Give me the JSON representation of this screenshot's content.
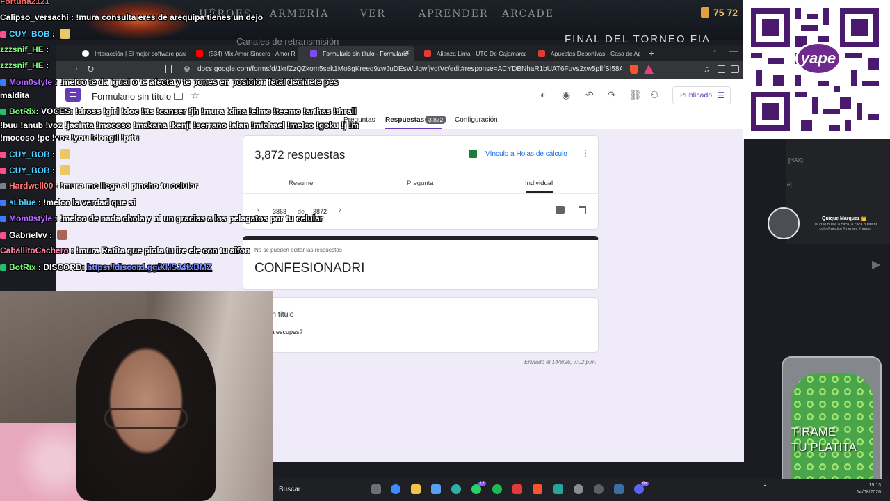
{
  "game": {
    "nav": [
      "HÉROES",
      "ARMERÍA",
      "VER",
      "APRENDER",
      "ARCADE"
    ],
    "gold": "75 72",
    "tournament": "FINAL DEL TORNEO FIA",
    "streams_label": "Canales de retransmisión"
  },
  "browser": {
    "tabs": [
      {
        "label": "Interacción | El mejor software para p",
        "active": false
      },
      {
        "label": "(534) Mix Amor Sincero - Amor R",
        "active": false
      },
      {
        "label": "Formulario sin título - Formulario",
        "active": true
      },
      {
        "label": "Alianza Lima - UTC De Cajamarca Fút",
        "active": false
      },
      {
        "label": "Apuestas Deportivas - Casa de Apue",
        "active": false
      }
    ],
    "new_tab": "+",
    "url": "docs.google.com/forms/d/1krfZzQZkom5sek1Mo8gKreeq9zwJuDEsWUgwfjyqtVc/edit#response=ACYDBNhaR1bUAT6Fuvs2xw5pflfSI58AfA3HBQ..."
  },
  "forms": {
    "title": "Formulario sin título",
    "publish_label": "Publicado",
    "tabs": {
      "questions": "Preguntas",
      "responses": "Respuestas",
      "settings": "Configuración"
    },
    "response_badge": "3,872",
    "summary": {
      "count_text": "3,872 respuestas",
      "sheets_link": "Vínculo a Hojas de cálculo",
      "subtabs": {
        "summary": "Resumen",
        "question": "Pregunta",
        "individual": "Individual"
      },
      "current": "3863",
      "of": "de",
      "total": "3872"
    },
    "response": {
      "no_edit": "No se pueden editar las respuestas",
      "title": "CONFESIONADRI",
      "question": "nta sin título",
      "answer": "jas o la escupes?",
      "sent": "Enviado el 14/8/26, 7:02 p.m."
    }
  },
  "chat": [
    {
      "user": "Fortuna2121",
      "color": "#ff6a6a",
      "text": ""
    },
    {
      "user": "Calipso_versachi",
      "color": "#ffffff",
      "text": "!mura consulta eres de arequipa tienes un dejo"
    },
    {
      "user": "CUY_BOB",
      "color": "#4fd1ff",
      "text": ""
    },
    {
      "user": "zzzsnif_HE",
      "color": "#7dff7d",
      "text": ""
    },
    {
      "user": "zzzsnif_HE",
      "color": "#7dff7d",
      "text": ""
    },
    {
      "user": "Mom0style",
      "color": "#b36bff",
      "text": "!melco te da igual o te afecta y te pones en posicion fetal decidete pes"
    },
    {
      "user": "",
      "color": "#ffffff",
      "text": "maldita"
    },
    {
      "user": "BotRix",
      "color": "#7dff7d",
      "text": "VOCES: !dross !girl !doc !tts !canser !jh !mura !dina !elmo !teemo !arthas !thrall"
    },
    {
      "user": "",
      "color": "#ffffff",
      "text": "!buu !anub !voz !jacinta !mocoso !makana !kenji !serrano !alan !michael !melco !goku !j !m"
    },
    {
      "user": "",
      "color": "#ffffff",
      "text": "!mocoso !pe !voz !you !dongil !pitu"
    },
    {
      "user": "CUY_BOB",
      "color": "#4fd1ff",
      "text": ""
    },
    {
      "user": "CUY_BOB",
      "color": "#4fd1ff",
      "text": ""
    },
    {
      "user": "Hardwell00",
      "color": "#ff7b7b",
      "text": "!mura me llega al pincho tu celular"
    },
    {
      "user": "sLblue",
      "color": "#4fd1ff",
      "text": "!melco la verdad que si"
    },
    {
      "user": "Mom0style",
      "color": "#b36bff",
      "text": "!melco de nada chola y ni un gracias a los pelagatos por tu celular"
    },
    {
      "user": "Gabrielvv",
      "color": "#ffffff",
      "text": ""
    },
    {
      "user": "CaballitoCachero",
      "color": "#ff8ab0",
      "text": "!mura Ratita que piola tu ire ele con tu aifon"
    },
    {
      "user": "BotRix",
      "color": "#7dff7d",
      "text": "DISCORD:",
      "link": "https://discord.gg/XHSJ4fxBMZ"
    }
  ],
  "overlay": {
    "qr_badge": "yape",
    "hax_tag": "[HAX]",
    "tag_2": "e]",
    "ticker_name": "Quique Márquez 👑",
    "ticker_text": "Tu culo huele a caca, a caca huele tu culo #mexico #memes #humor",
    "jar_text_1": "TIRAME",
    "jar_text_2": "TU PLATITA"
  },
  "taskbar": {
    "search": "Buscar",
    "wa_badge": "17",
    "dc_badge": "9+",
    "clock_time": "19:13",
    "clock_date": "14/08/2026"
  }
}
